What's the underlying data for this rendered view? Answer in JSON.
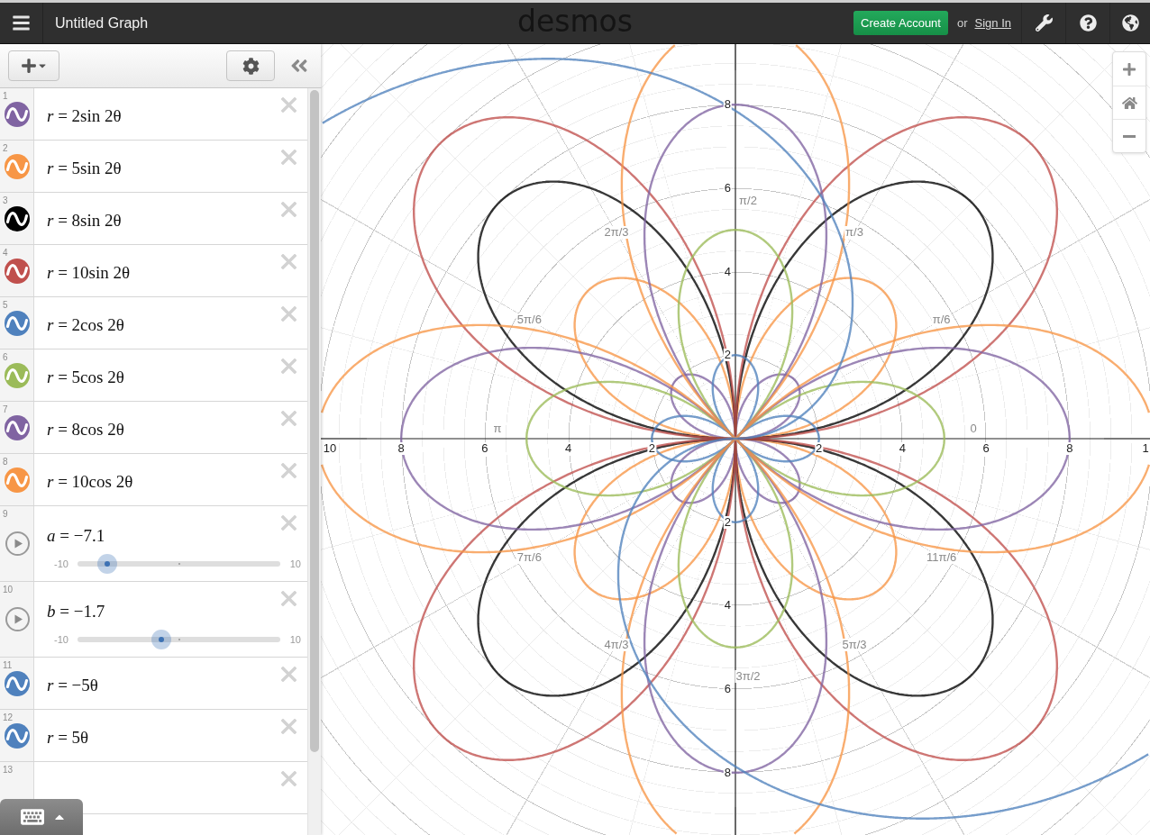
{
  "header": {
    "title": "Untitled Graph",
    "logo": "desmos",
    "create_account": "Create Account",
    "or_text": "or",
    "sign_in": "Sign In"
  },
  "expressions": [
    {
      "kind": "expression",
      "number": "1",
      "formula": "*r* = 2sin 2θ",
      "color": "#8064a2"
    },
    {
      "kind": "expression",
      "number": "2",
      "formula": "*r* = 5sin 2θ",
      "color": "#f79646"
    },
    {
      "kind": "expression",
      "number": "3",
      "formula": "*r* = 8sin 2θ",
      "color": "#000000"
    },
    {
      "kind": "expression",
      "number": "4",
      "formula": "*r* = 10sin 2θ",
      "color": "#c0504d"
    },
    {
      "kind": "expression",
      "number": "5",
      "formula": "*r* = 2cos 2θ",
      "color": "#4f81bd"
    },
    {
      "kind": "expression",
      "number": "6",
      "formula": "*r* = 5cos 2θ",
      "color": "#9bbb59"
    },
    {
      "kind": "expression",
      "number": "7",
      "formula": "*r* = 8cos 2θ",
      "color": "#8064a2"
    },
    {
      "kind": "expression",
      "number": "8",
      "formula": "*r* = 10cos 2θ",
      "color": "#f79646"
    },
    {
      "kind": "slider",
      "number": "9",
      "formula": "*a* = −7.1",
      "min": "-10",
      "max": "10",
      "level": 0.145
    },
    {
      "kind": "slider",
      "number": "10",
      "formula": "*b* = −1.7",
      "min": "-10",
      "max": "10",
      "level": 0.415
    },
    {
      "kind": "expression",
      "number": "11",
      "formula": "*r* = −5θ",
      "color": "#4f81bd"
    },
    {
      "kind": "expression",
      "number": "12",
      "formula": "*r* = 5θ",
      "color": "#4f81bd"
    },
    {
      "kind": "empty",
      "number": "13"
    }
  ],
  "graph": {
    "x_axis_labels": [
      "10",
      "8",
      "6",
      "4",
      "2",
      "2",
      "4",
      "6",
      "8",
      "1"
    ],
    "y_axis_labels": [
      "8",
      "6",
      "4",
      "2",
      "2",
      "4",
      "6",
      "8"
    ],
    "angle_labels": [
      "0",
      "π/6",
      "π/3",
      "π/2",
      "2π/3",
      "5π/6",
      "π",
      "7π/6",
      "4π/3",
      "3π/2",
      "5π/3",
      "11π/6"
    ]
  }
}
